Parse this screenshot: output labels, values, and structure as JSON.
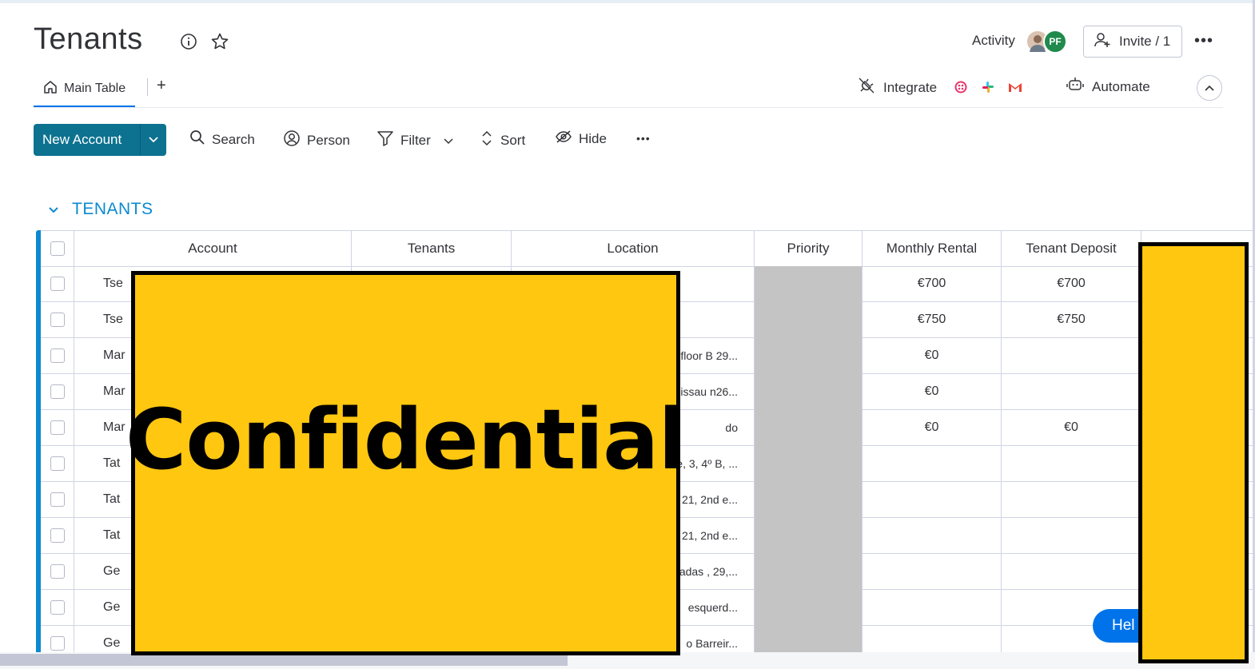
{
  "header": {
    "title": "Tenants",
    "activity_label": "Activity",
    "avatar_initials": "PF",
    "invite_label": "Invite / 1"
  },
  "tabs": {
    "main_table": "Main Table",
    "add": "+"
  },
  "integrations": {
    "integrate_label": "Integrate",
    "automate_label": "Automate"
  },
  "toolbar": {
    "new_item_label": "New Account",
    "search_label": "Search",
    "person_label": "Person",
    "filter_label": "Filter",
    "sort_label": "Sort",
    "hide_label": "Hide"
  },
  "group": {
    "title": "TENANTS",
    "color": "#0b8ad0"
  },
  "table": {
    "columns": [
      "Account",
      "Tenants",
      "Location",
      "Priority",
      "Monthly Rental",
      "Tenant Deposit"
    ],
    "rows": [
      {
        "account": "Tse",
        "location": "",
        "monthly_rental": "€700",
        "tenant_deposit": "€700"
      },
      {
        "account": "Tse",
        "location": "",
        "monthly_rental": "€750",
        "tenant_deposit": "€750"
      },
      {
        "account": "Mar",
        "location": "floor B 29...",
        "monthly_rental": "€0",
        "tenant_deposit": ""
      },
      {
        "account": "Mar",
        "location": "issau n26...",
        "monthly_rental": "€0",
        "tenant_deposit": ""
      },
      {
        "account": "Mar",
        "location": "do",
        "monthly_rental": "€0",
        "tenant_deposit": "€0"
      },
      {
        "account": "Tat",
        "location": "e, 3, 4º B, ...",
        "monthly_rental": "",
        "tenant_deposit": ""
      },
      {
        "account": "Tat",
        "location": "21, 2nd e...",
        "monthly_rental": "",
        "tenant_deposit": ""
      },
      {
        "account": "Tat",
        "location": "21, 2nd e...",
        "monthly_rental": "",
        "tenant_deposit": ""
      },
      {
        "account": "Ge",
        "location": "adas , 29,...",
        "monthly_rental": "",
        "tenant_deposit": ""
      },
      {
        "account": "Ge",
        "location": "esquerd...",
        "monthly_rental": "",
        "tenant_deposit": ""
      },
      {
        "account": "Ge",
        "location": "o Barreir...",
        "monthly_rental": "",
        "tenant_deposit": ""
      }
    ]
  },
  "help_label": "Hel",
  "redaction": {
    "label": "Confidential",
    "color": "#ffc710"
  },
  "colors": {
    "primary_button": "#0c7290",
    "accent_blue": "#0073ea",
    "priority_empty": "#c4c4c4"
  }
}
